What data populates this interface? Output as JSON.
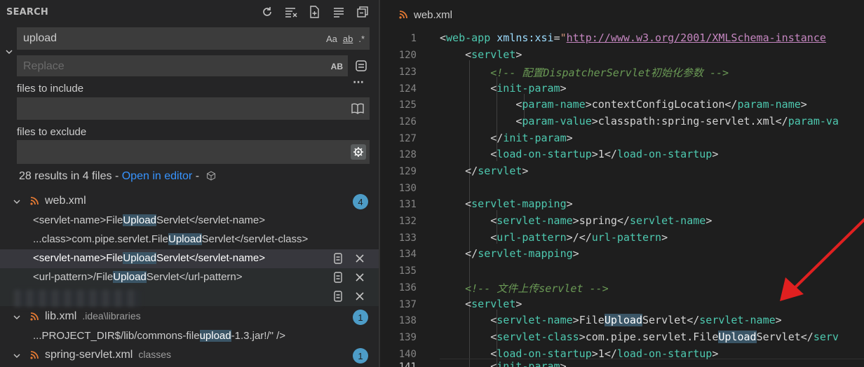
{
  "sidebar": {
    "title": "SEARCH",
    "actions": [
      "refresh-icon",
      "clear-results-icon",
      "new-search-editor-icon",
      "collapse-all-icon",
      "expand-all-icon"
    ],
    "search": {
      "value": "upload",
      "opt_case": "Aa",
      "opt_word": "ab",
      "opt_regex": ".*"
    },
    "replace": {
      "placeholder": "Replace",
      "opt_preserve": "AB"
    },
    "more": "···",
    "include": {
      "label": "files to include",
      "value": ""
    },
    "exclude": {
      "label": "files to exclude",
      "value": ""
    },
    "summary": {
      "text": "28 results in 4 files - ",
      "open_link": "Open in editor",
      "sep": " -"
    },
    "files": [
      {
        "name": "web.xml",
        "path": "",
        "count": "4"
      },
      {
        "name": "lib.xml",
        "path": ".idea\\libraries",
        "count": "1"
      },
      {
        "name": "spring-servlet.xml",
        "path": "classes",
        "count": "1"
      }
    ],
    "matches": [
      {
        "pre": "<servlet-name>File",
        "hit": "Upload",
        "post": "Servlet</servlet-name>"
      },
      {
        "pre": "...class>com.pipe.servlet.File",
        "hit": "Upload",
        "post": "Servlet</servlet-class>"
      },
      {
        "pre": "<servlet-name>File",
        "hit": "Upload",
        "post": "Servlet</servlet-name>"
      },
      {
        "pre": "<url-pattern>/File",
        "hit": "Upload",
        "post": "Servlet</url-pattern>"
      },
      {
        "pre": "...PROJECT_DIR$/lib/commons-file",
        "hit": "upload",
        "post": "-1.3.jar!/\" />"
      }
    ]
  },
  "editor": {
    "tab": "web.xml",
    "line_numbers": [
      "1",
      "120",
      "123",
      "124",
      "125",
      "126",
      "127",
      "128",
      "129",
      "130",
      "131",
      "132",
      "133",
      "134",
      "135",
      "136",
      "137",
      "138",
      "139",
      "140",
      "141"
    ],
    "current_line": "141"
  },
  "colors": {
    "accent": "#3794ff",
    "badge": "#4d9cc7",
    "tag": "#4ec9b0",
    "attr": "#9cdcfe",
    "comment": "#6a9955",
    "arrow": "#e02020"
  }
}
